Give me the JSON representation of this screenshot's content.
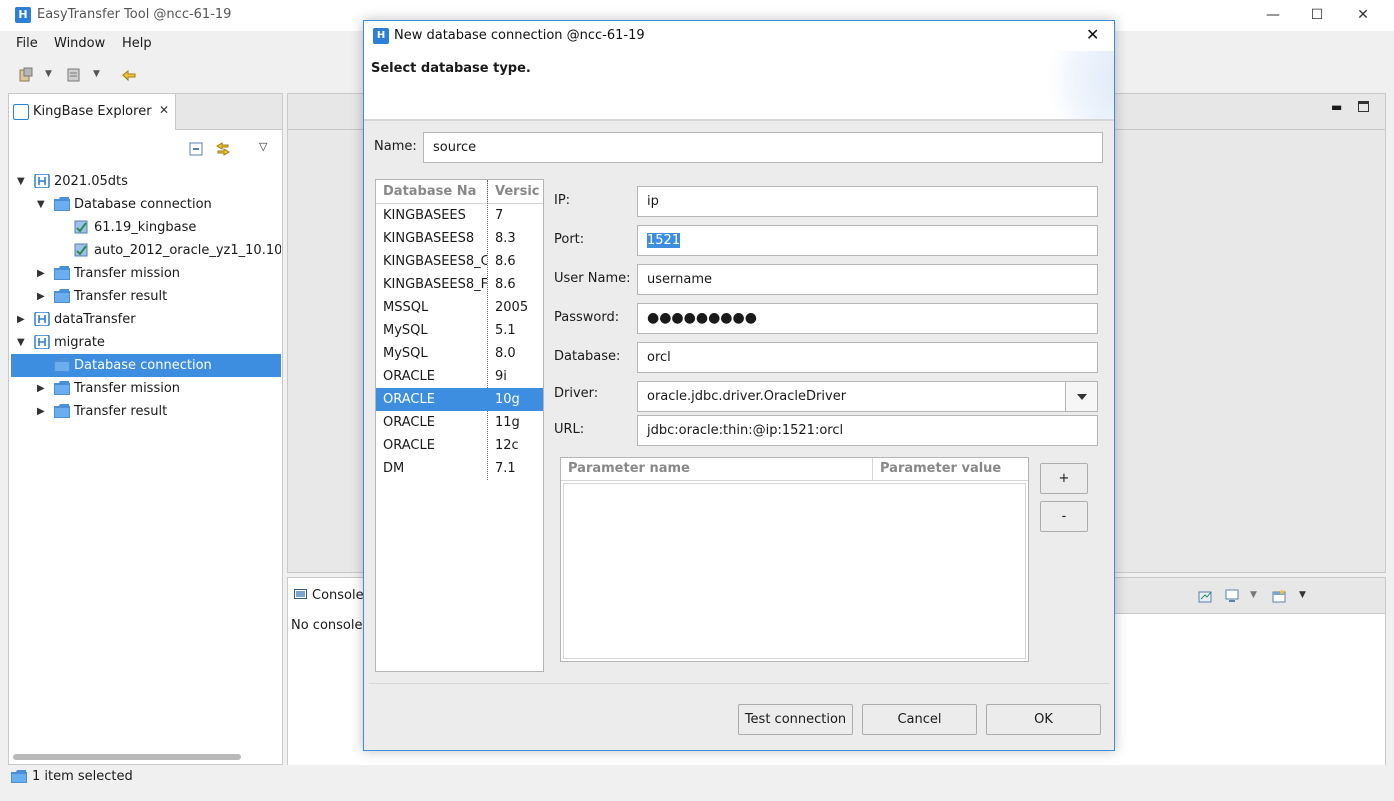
{
  "app": {
    "title": "EasyTransfer Tool @ncc-61-19",
    "icon": "app-logo-icon"
  },
  "window_controls": {
    "minimize": "—",
    "maximize": "☐",
    "close": "✕"
  },
  "menu": {
    "file": "File",
    "window": "Window",
    "help": "Help"
  },
  "explorer": {
    "tab_label": "KingBase Explorer",
    "tree": [
      {
        "label": "2021.05dts",
        "level": 0,
        "expanded": true,
        "icon": "project-icon"
      },
      {
        "label": "Database connection",
        "level": 1,
        "expanded": true,
        "icon": "folder-icon"
      },
      {
        "label": "61.19_kingbase",
        "level": 2,
        "icon": "db-connection-icon"
      },
      {
        "label": "auto_2012_oracle_yz1_10.10",
        "level": 2,
        "icon": "db-connection-icon"
      },
      {
        "label": "Transfer mission",
        "level": 1,
        "expanded": false,
        "icon": "folder-icon"
      },
      {
        "label": "Transfer result",
        "level": 1,
        "expanded": false,
        "icon": "folder-icon"
      },
      {
        "label": "dataTransfer",
        "level": 0,
        "expanded": false,
        "icon": "project-icon"
      },
      {
        "label": "migrate",
        "level": 0,
        "expanded": true,
        "icon": "project-icon"
      },
      {
        "label": "Database connection",
        "level": 1,
        "selected": true,
        "icon": "folder-icon"
      },
      {
        "label": "Transfer mission",
        "level": 1,
        "expanded": false,
        "icon": "folder-icon"
      },
      {
        "label": "Transfer result",
        "level": 1,
        "expanded": false,
        "icon": "folder-icon"
      }
    ]
  },
  "console": {
    "tab_label": "Console",
    "message": "No console"
  },
  "status": {
    "text": "1 item selected"
  },
  "dialog": {
    "title": "New database connection @ncc-61-19",
    "heading": "Select database type.",
    "name_label": "Name:",
    "name_value": "source",
    "db_table": {
      "headers": [
        "Database Na",
        "Versic"
      ],
      "rows": [
        [
          "KINGBASEES",
          "7"
        ],
        [
          "KINGBASEES8",
          "8.3"
        ],
        [
          "KINGBASEES8_C",
          "8.6"
        ],
        [
          "KINGBASEES8_F",
          "8.6"
        ],
        [
          "MSSQL",
          "2005"
        ],
        [
          "MySQL",
          "5.1"
        ],
        [
          "MySQL",
          "8.0"
        ],
        [
          "ORACLE",
          "9i"
        ],
        [
          "ORACLE",
          "10g"
        ],
        [
          "ORACLE",
          "11g"
        ],
        [
          "ORACLE",
          "12c"
        ],
        [
          "DM",
          "7.1"
        ]
      ],
      "selected_index": 8
    },
    "fields": {
      "ip_label": "IP:",
      "ip_value": "ip",
      "port_label": "Port:",
      "port_value": "1521",
      "user_label": "User Name:",
      "user_value": "username",
      "password_label": "Password:",
      "password_value": "●●●●●●●●●",
      "database_label": "Database:",
      "database_value": "orcl",
      "driver_label": "Driver:",
      "driver_value": "oracle.jdbc.driver.OracleDriver",
      "url_label": "URL:",
      "url_value": "jdbc:oracle:thin:@ip:1521:orcl"
    },
    "params": {
      "col_name": "Parameter name",
      "col_value": "Parameter value"
    },
    "buttons": {
      "add": "+",
      "remove": "-",
      "test": "Test connection",
      "cancel": "Cancel",
      "ok": "OK"
    }
  }
}
